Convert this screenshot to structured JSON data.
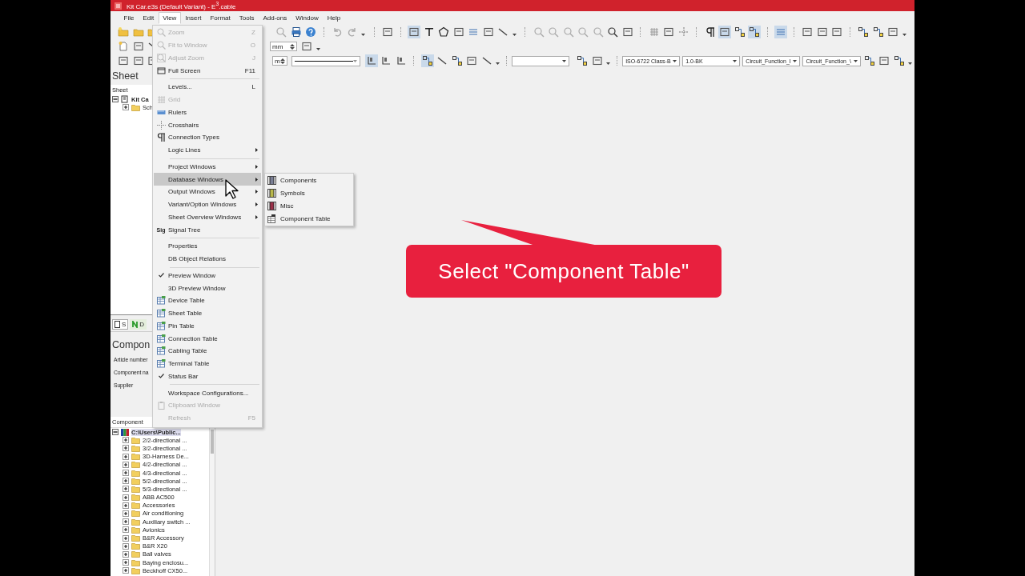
{
  "window": {
    "title": "Kit Car.e3s (Default Variant) - E$^{3}$.cable"
  },
  "menu_bar": [
    {
      "label": "File",
      "selected": false
    },
    {
      "label": "Edit",
      "selected": false
    },
    {
      "label": "View",
      "selected": true
    },
    {
      "label": "Insert",
      "selected": false
    },
    {
      "label": "Format",
      "selected": false
    },
    {
      "label": "Tools",
      "selected": false
    },
    {
      "label": "Add-ons",
      "selected": false
    },
    {
      "label": "Window",
      "selected": false
    },
    {
      "label": "Help",
      "selected": false
    }
  ],
  "toolbar": {
    "unit_fields": [
      {
        "value": "mm"
      },
      {
        "value": "m"
      }
    ],
    "combos": [
      {
        "value": "ISO-6722 Class-B"
      },
      {
        "value": "1.0-BK"
      },
      {
        "value": "Circuit_Function_I"
      },
      {
        "value": "Circuit_Function_\\"
      }
    ]
  },
  "sheet_panel": {
    "title": "Sheet",
    "column_header": "Sheet",
    "tree": [
      {
        "label": "Kit Ca",
        "expanded": true,
        "children": [
          {
            "label": "Sch",
            "expanded": false
          }
        ]
      }
    ]
  },
  "panel_tabs": [
    {
      "label": "S",
      "selected": true
    },
    {
      "label": "D",
      "selected": false
    }
  ],
  "component_panel": {
    "title": "Compon",
    "fields": [
      {
        "label": "Article number"
      },
      {
        "label": "Component na"
      },
      {
        "label": "Supplier"
      }
    ]
  },
  "component_tree": {
    "column_header": "Component",
    "tree": [
      {
        "label": "C:\\Users\\Public...",
        "expanded": true,
        "selected": true,
        "children": [
          {
            "label": "2/2-directional ...",
            "expanded": false,
            "selected": false
          },
          {
            "label": "3/2-directional ...",
            "expanded": false,
            "selected": false
          },
          {
            "label": "3D-Harness De...",
            "expanded": false,
            "selected": false
          },
          {
            "label": "4/2-directional ...",
            "expanded": false,
            "selected": false
          },
          {
            "label": "4/3-directional ...",
            "expanded": false,
            "selected": false
          },
          {
            "label": "5/2-directional ...",
            "expanded": false,
            "selected": false
          },
          {
            "label": "5/3-directional ...",
            "expanded": false,
            "selected": false
          },
          {
            "label": "ABB AC500",
            "expanded": false,
            "selected": false
          },
          {
            "label": "Accessories",
            "expanded": false,
            "selected": false
          },
          {
            "label": "Air conditioning",
            "expanded": false,
            "selected": false
          },
          {
            "label": "Auxiliary switch ...",
            "expanded": false,
            "selected": false
          },
          {
            "label": "Avionics",
            "expanded": false,
            "selected": false
          },
          {
            "label": "B&R Accessory",
            "expanded": false,
            "selected": false
          },
          {
            "label": "B&R X20",
            "expanded": false,
            "selected": false
          },
          {
            "label": "Ball valves",
            "expanded": false,
            "selected": false
          },
          {
            "label": "Baying enclosu...",
            "expanded": false,
            "selected": false
          },
          {
            "label": "Beckhoff CX50...",
            "expanded": false,
            "selected": false
          }
        ]
      }
    ]
  },
  "view_menu": {
    "groups": [
      [
        {
          "label": "Zoom",
          "shortcut": "Z",
          "submenu": false,
          "disabled": true,
          "checked": false,
          "selected": false
        },
        {
          "label": "Fit to Window",
          "shortcut": "O",
          "submenu": false,
          "disabled": true,
          "checked": false,
          "selected": false
        },
        {
          "label": "Adjust Zoom",
          "shortcut": "J",
          "submenu": false,
          "disabled": true,
          "checked": false,
          "selected": false
        },
        {
          "label": "Full Screen",
          "shortcut": "F11",
          "submenu": false,
          "disabled": false,
          "checked": false,
          "selected": false
        }
      ],
      [
        {
          "label": "Levels...",
          "shortcut": "L",
          "submenu": false,
          "disabled": false,
          "checked": false,
          "selected": false
        },
        {
          "label": "Grid",
          "submenu": false,
          "disabled": true,
          "checked": false,
          "selected": false
        },
        {
          "label": "Rulers",
          "submenu": false,
          "disabled": false,
          "checked": false,
          "selected": false
        },
        {
          "label": "Crosshairs",
          "submenu": false,
          "disabled": false,
          "checked": false,
          "selected": false
        },
        {
          "label": "Connection Types",
          "submenu": false,
          "disabled": false,
          "checked": false,
          "selected": false
        },
        {
          "label": "Logic Lines",
          "submenu": true,
          "disabled": false,
          "checked": false,
          "selected": false
        }
      ],
      [
        {
          "label": "Project Windows",
          "submenu": true,
          "disabled": false,
          "checked": false,
          "selected": false
        },
        {
          "label": "Database Windows",
          "submenu": true,
          "disabled": false,
          "checked": false,
          "selected": true
        },
        {
          "label": "Output Windows",
          "submenu": true,
          "disabled": false,
          "checked": false,
          "selected": false
        },
        {
          "label": "Variant/Option Windows",
          "submenu": true,
          "disabled": false,
          "checked": false,
          "selected": false
        },
        {
          "label": "Sheet Overview Windows",
          "submenu": true,
          "disabled": false,
          "checked": false,
          "selected": false
        },
        {
          "label": "Signal Tree",
          "icon_text": "Sig",
          "submenu": false,
          "disabled": false,
          "checked": false,
          "selected": false
        }
      ],
      [
        {
          "label": "Properties",
          "submenu": false,
          "disabled": false,
          "checked": false,
          "selected": false
        },
        {
          "label": "DB Object Relations",
          "submenu": false,
          "disabled": false,
          "checked": false,
          "selected": false
        }
      ],
      [
        {
          "label": "Preview Window",
          "submenu": false,
          "disabled": false,
          "checked": true,
          "selected": false
        },
        {
          "label": "3D Preview Window",
          "submenu": false,
          "disabled": false,
          "checked": false,
          "selected": false
        },
        {
          "label": "Device Table",
          "submenu": false,
          "disabled": false,
          "checked": false,
          "selected": false
        },
        {
          "label": "Sheet Table",
          "submenu": false,
          "disabled": false,
          "checked": false,
          "selected": false
        },
        {
          "label": "Pin Table",
          "submenu": false,
          "disabled": false,
          "checked": false,
          "selected": false
        },
        {
          "label": "Connection Table",
          "submenu": false,
          "disabled": false,
          "checked": false,
          "selected": false
        },
        {
          "label": "Cabling Table",
          "submenu": false,
          "disabled": false,
          "checked": false,
          "selected": false
        },
        {
          "label": "Terminal Table",
          "submenu": false,
          "disabled": false,
          "checked": false,
          "selected": false
        },
        {
          "label": "Status Bar",
          "submenu": false,
          "disabled": false,
          "checked": true,
          "selected": false
        }
      ],
      [
        {
          "label": "Workspace Configurations...",
          "submenu": false,
          "disabled": false,
          "checked": false,
          "selected": false
        },
        {
          "label": "Clipboard Window",
          "submenu": false,
          "disabled": true,
          "checked": false,
          "selected": false
        },
        {
          "label": "Refresh",
          "shortcut": "F5",
          "submenu": false,
          "disabled": true,
          "checked": false,
          "selected": false
        }
      ]
    ]
  },
  "submenu": {
    "items": [
      {
        "label": "Components",
        "color": "#7a7f95"
      },
      {
        "label": "Symbols",
        "color": "#b9b84a"
      },
      {
        "label": "Misc",
        "color": "#9a3048"
      },
      {
        "label": "Component Table",
        "kind": "table"
      }
    ]
  },
  "callout": {
    "text": "Select \"Component Table\""
  }
}
